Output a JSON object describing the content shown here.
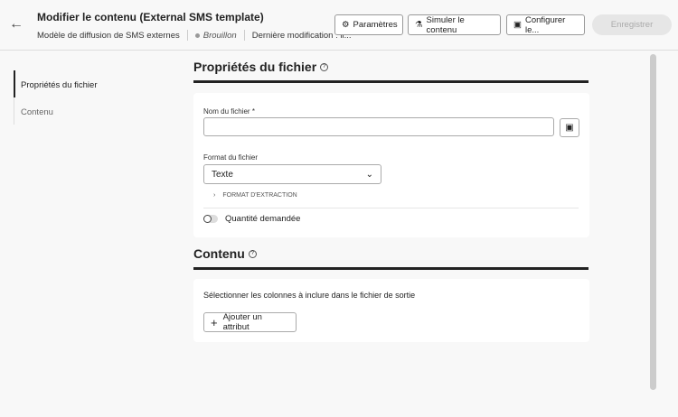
{
  "header": {
    "title": "Modifier le contenu (External SMS template)",
    "subtitle": "Modèle de diffusion de SMS externes",
    "status": "Brouillon",
    "last_modified": "Dernière modification : il..."
  },
  "toolbar": {
    "settings": "Paramètres",
    "simulate": "Simuler le contenu",
    "configure": "Configurer le...",
    "save": "Enregistrer"
  },
  "nav": {
    "items": [
      {
        "label": "Propriétés du fichier"
      },
      {
        "label": "Contenu"
      }
    ]
  },
  "file_props": {
    "title": "Propriétés du fichier",
    "help": "?",
    "filename_label": "Nom du fichier",
    "required": "*",
    "filename_value": "",
    "format_label": "Format du fichier",
    "format_value": "Texte",
    "extraction": "FORMAT D'EXTRACTION",
    "quantity_label": "Quantité demandée"
  },
  "content": {
    "title": "Contenu",
    "help": "?",
    "description": "Sélectionner les colonnes à inclure dans le fichier de sortie",
    "add_attribute": "Ajouter un attribut"
  }
}
